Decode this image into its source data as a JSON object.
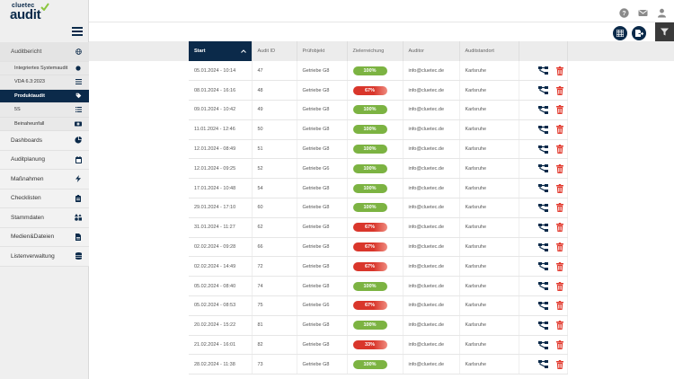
{
  "app": {
    "logo_top": "cluetec",
    "logo_main": "audit"
  },
  "sidebar": {
    "head": {
      "label": "Auditbericht",
      "icon": "globe-icon"
    },
    "subitems": [
      {
        "label": "Integriertes Systemaudit",
        "icon": "circle-icon"
      },
      {
        "label": "VDA 6.3:2023",
        "icon": "list-icon"
      },
      {
        "label": "Produktaudit",
        "icon": "tag-icon"
      },
      {
        "label": "5S",
        "icon": "list-icon"
      },
      {
        "label": "Beinaheunfall",
        "icon": "ambulance-icon"
      }
    ],
    "items": [
      {
        "label": "Dashboards",
        "icon": "pie-chart-icon"
      },
      {
        "label": "Auditplanung",
        "icon": "calendar-icon"
      },
      {
        "label": "Maßnahmen",
        "icon": "bolt-icon"
      },
      {
        "label": "Checklisten",
        "icon": "clipboard-icon"
      },
      {
        "label": "Stammdaten",
        "icon": "shapes-icon"
      },
      {
        "label": "Medien&Dateien",
        "icon": "file-icon"
      },
      {
        "label": "Listenverwaltung",
        "icon": "database-icon"
      }
    ]
  },
  "colors": {
    "brand": "#0b2a4a",
    "success": "#7cb342",
    "danger": "#d9362b"
  },
  "table": {
    "columns": [
      "Start",
      "Audit ID",
      "Prüfobjekt",
      "Zielerreichung",
      "Auditor",
      "Auditstandort"
    ],
    "rows": [
      {
        "start": "05.01.2024 - 10:14",
        "id": "47",
        "obj": "Getriebe G8",
        "score": "100%",
        "auditor": "info@cluetec.de",
        "site": "Karlsruhe"
      },
      {
        "start": "08.01.2024 - 16:16",
        "id": "48",
        "obj": "Getriebe G8",
        "score": "67%",
        "auditor": "info@cluetec.de",
        "site": "Karlsruhe"
      },
      {
        "start": "09.01.2024 - 10:42",
        "id": "49",
        "obj": "Getriebe G8",
        "score": "100%",
        "auditor": "info@cluetec.de",
        "site": "Karlsruhe"
      },
      {
        "start": "11.01.2024 - 12:46",
        "id": "50",
        "obj": "Getriebe G8",
        "score": "100%",
        "auditor": "info@cluetec.de",
        "site": "Karlsruhe"
      },
      {
        "start": "12.01.2024 - 08:49",
        "id": "51",
        "obj": "Getriebe G8",
        "score": "100%",
        "auditor": "info@cluetec.de",
        "site": "Karlsruhe"
      },
      {
        "start": "12.01.2024 - 09:25",
        "id": "52",
        "obj": "Getriebe G6",
        "score": "100%",
        "auditor": "info@cluetec.de",
        "site": "Karlsruhe"
      },
      {
        "start": "17.01.2024 - 10:48",
        "id": "54",
        "obj": "Getriebe G8",
        "score": "100%",
        "auditor": "info@cluetec.de",
        "site": "Karlsruhe"
      },
      {
        "start": "29.01.2024 - 17:10",
        "id": "60",
        "obj": "Getriebe G8",
        "score": "100%",
        "auditor": "info@cluetec.de",
        "site": "Karlsruhe"
      },
      {
        "start": "31.01.2024 - 11:27",
        "id": "62",
        "obj": "Getriebe G8",
        "score": "67%",
        "auditor": "info@cluetec.de",
        "site": "Karlsruhe"
      },
      {
        "start": "02.02.2024 - 09:28",
        "id": "66",
        "obj": "Getriebe G8",
        "score": "67%",
        "auditor": "info@cluetec.de",
        "site": "Karlsruhe"
      },
      {
        "start": "02.02.2024 - 14:49",
        "id": "72",
        "obj": "Getriebe G8",
        "score": "67%",
        "auditor": "info@cluetec.de",
        "site": "Karlsruhe"
      },
      {
        "start": "05.02.2024 - 08:40",
        "id": "74",
        "obj": "Getriebe G8",
        "score": "100%",
        "auditor": "info@cluetec.de",
        "site": "Karlsruhe"
      },
      {
        "start": "05.02.2024 - 08:53",
        "id": "75",
        "obj": "Getriebe G6",
        "score": "67%",
        "auditor": "info@cluetec.de",
        "site": "Karlsruhe"
      },
      {
        "start": "20.02.2024 - 15:22",
        "id": "81",
        "obj": "Getriebe G8",
        "score": "100%",
        "auditor": "info@cluetec.de",
        "site": "Karlsruhe"
      },
      {
        "start": "21.02.2024 - 16:01",
        "id": "82",
        "obj": "Getriebe G8",
        "score": "33%",
        "auditor": "info@cluetec.de",
        "site": "Karlsruhe"
      },
      {
        "start": "28.02.2024 - 11:38",
        "id": "73",
        "obj": "Getriebe G8",
        "score": "100%",
        "auditor": "info@cluetec.de",
        "site": "Karlsruhe"
      }
    ],
    "row_actions": [
      "hierarchy-icon",
      "trash-icon"
    ]
  },
  "topbar": {
    "icons": [
      "help-icon",
      "mail-icon",
      "user-icon"
    ]
  },
  "toolbar": {
    "icons": [
      "grid-view-icon",
      "export-icon",
      "filter-icon"
    ]
  }
}
